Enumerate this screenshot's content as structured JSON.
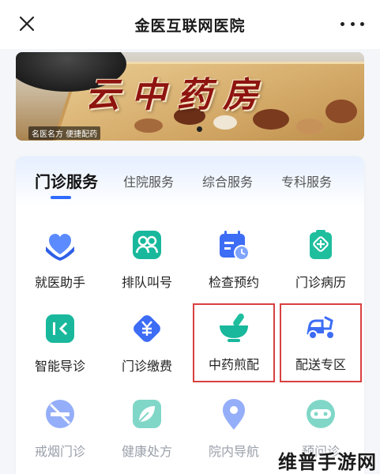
{
  "header": {
    "title": "金医互联网医院",
    "close_icon": "close-icon",
    "more_icon": "more-icon"
  },
  "banner": {
    "brand_text": "云中药房",
    "slogan": "名医名方 便捷配药"
  },
  "tabs": [
    {
      "label": "门诊服务",
      "active": true
    },
    {
      "label": "住院服务",
      "active": false
    },
    {
      "label": "综合服务",
      "active": false
    },
    {
      "label": "专科服务",
      "active": false
    }
  ],
  "services": [
    {
      "label": "就医助手",
      "icon": "heart-hands-icon"
    },
    {
      "label": "排队叫号",
      "icon": "people-icon"
    },
    {
      "label": "检查预约",
      "icon": "calendar-clock-icon"
    },
    {
      "label": "门诊病历",
      "icon": "medical-record-icon"
    },
    {
      "label": "智能导诊",
      "icon": "guide-icon"
    },
    {
      "label": "门诊缴费",
      "icon": "yuan-payment-icon"
    },
    {
      "label": "中药煎配",
      "icon": "mortar-pestle-icon"
    },
    {
      "label": "配送专区",
      "icon": "scooter-icon"
    },
    {
      "label": "戒烟门诊",
      "icon": "no-smoking-icon"
    },
    {
      "label": "健康处方",
      "icon": "leaf-icon"
    },
    {
      "label": "院内导航",
      "icon": "location-pin-icon"
    },
    {
      "label": "预问诊",
      "icon": "robot-icon"
    }
  ],
  "watermark": "维普手游网",
  "colors": {
    "accent": "#2f6bff",
    "highlight_border": "#d94040",
    "brand_red": "#8e1410"
  }
}
